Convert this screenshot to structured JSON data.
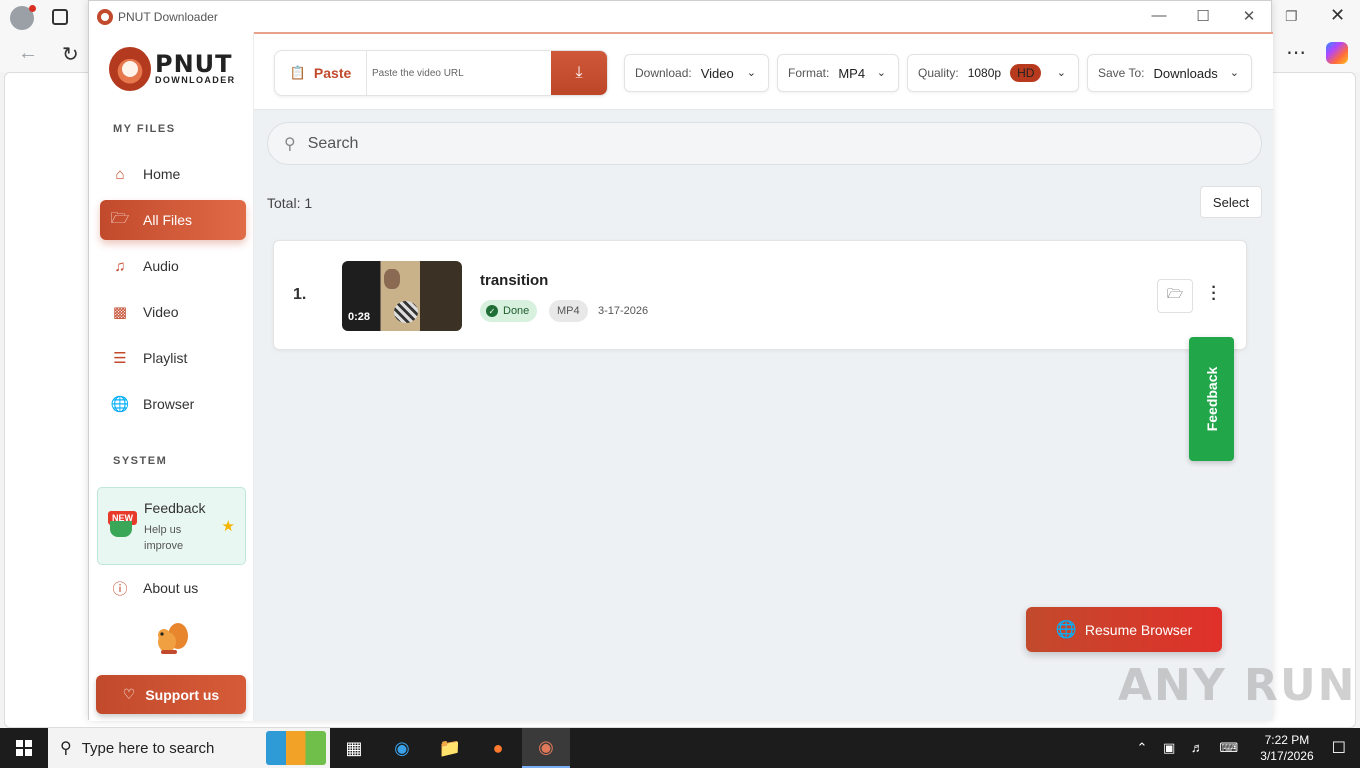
{
  "window": {
    "title": "PNUT Downloader"
  },
  "logo": {
    "line1": "PNUT",
    "line2": "DOWNLOADER"
  },
  "sidebar": {
    "my_files_label": "MY FILES",
    "system_label": "SYSTEM",
    "items": [
      {
        "label": "Home",
        "icon": "home-icon"
      },
      {
        "label": "All Files",
        "icon": "folder-open-icon",
        "active": true
      },
      {
        "label": "Audio",
        "icon": "music-icon"
      },
      {
        "label": "Video",
        "icon": "video-icon"
      },
      {
        "label": "Playlist",
        "icon": "list-icon"
      },
      {
        "label": "Browser",
        "icon": "globe-icon"
      }
    ],
    "feedback": {
      "badge": "NEW",
      "title": "Feedback",
      "subtitle": "Help us improve"
    },
    "about": "About us",
    "support": "Support us"
  },
  "toolbar": {
    "paste_label": "Paste",
    "url_placeholder": "Paste the video URL",
    "download": {
      "label": "Download:",
      "value": "Video"
    },
    "format": {
      "label": "Format:",
      "value": "MP4"
    },
    "quality": {
      "label": "Quality:",
      "value": "1080p",
      "badge": "HD"
    },
    "save_to": {
      "label": "Save To:",
      "value": "Downloads"
    }
  },
  "search": {
    "placeholder": "Search"
  },
  "list": {
    "total_label": "Total: 1",
    "select_label": "Select",
    "files": [
      {
        "index": "1.",
        "name": "transition",
        "duration": "0:28",
        "status": "Done",
        "format": "MP4",
        "date": "3-17-2026"
      }
    ]
  },
  "feedback_tab": "Feedback",
  "resume_browser": "Resume Browser",
  "watermark": "ANY RUN",
  "taskbar": {
    "search_text": "Type here to search",
    "time": "7:22 PM",
    "date": "3/17/2026"
  },
  "colors": {
    "accent": "#c24a2c",
    "feedback_green": "#22a64a",
    "done_green": "#d8f0de"
  }
}
